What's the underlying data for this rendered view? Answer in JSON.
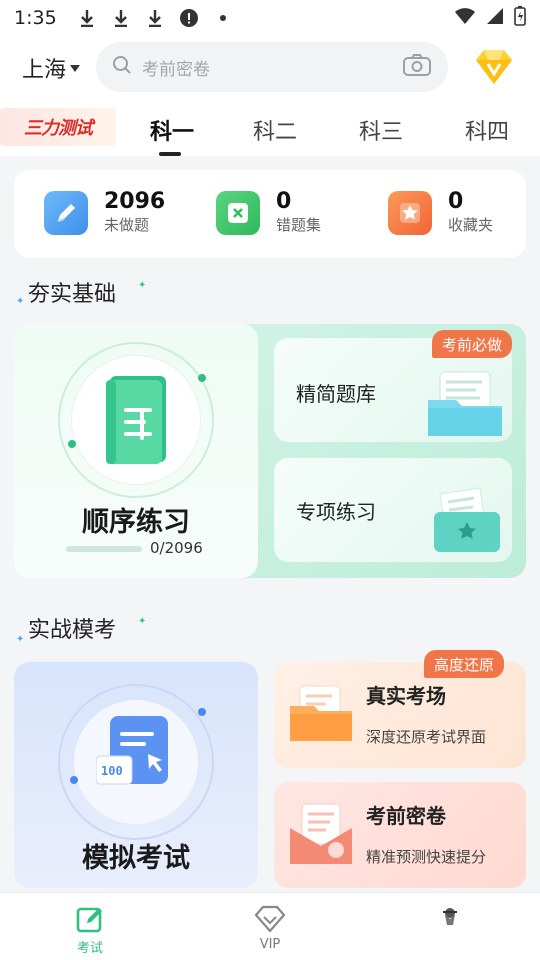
{
  "status_bar": {
    "time": "1:35"
  },
  "header": {
    "city": "上海",
    "search_placeholder": "考前密卷"
  },
  "promo": {
    "text": "三力测试"
  },
  "tabs": [
    {
      "label": "科一",
      "active": true
    },
    {
      "label": "科二",
      "active": false
    },
    {
      "label": "科三",
      "active": false
    },
    {
      "label": "科四",
      "active": false
    }
  ],
  "stats": [
    {
      "value": "2096",
      "label": "未做题",
      "icon": "pencil-icon",
      "color": "#4a9ff0"
    },
    {
      "value": "0",
      "label": "错题集",
      "icon": "close-box-icon",
      "color": "#37c46c"
    },
    {
      "value": "0",
      "label": "收藏夹",
      "icon": "star-icon",
      "color": "#f5763f"
    }
  ],
  "sections": {
    "basics": {
      "title": "夯实基础",
      "sequential": {
        "title": "顺序练习",
        "progress": "0/2096",
        "progress_fraction": 0.0
      },
      "curated": {
        "label": "精简题库",
        "tag": "考前必做"
      },
      "topics": {
        "label": "专项练习"
      }
    },
    "mock": {
      "title": "实战模考",
      "simulate": {
        "title": "模拟考试"
      },
      "real_exam": {
        "title": "真实考场",
        "subtitle": "深度还原考试界面",
        "tag": "高度还原"
      },
      "secret": {
        "title": "考前密卷",
        "subtitle": "精准预测快速提分"
      }
    }
  },
  "bottom_nav": [
    {
      "label": "考试",
      "icon": "exam-edit-icon",
      "active": true
    },
    {
      "label": "VIP",
      "icon": "diamond-icon",
      "active": false
    },
    {
      "label": "",
      "icon": "avatar-icon",
      "active": false
    }
  ],
  "colors": {
    "accent_green": "#2fbf7f",
    "tag_orange": "#f0764a",
    "mock_blue": "#4b87f0"
  }
}
